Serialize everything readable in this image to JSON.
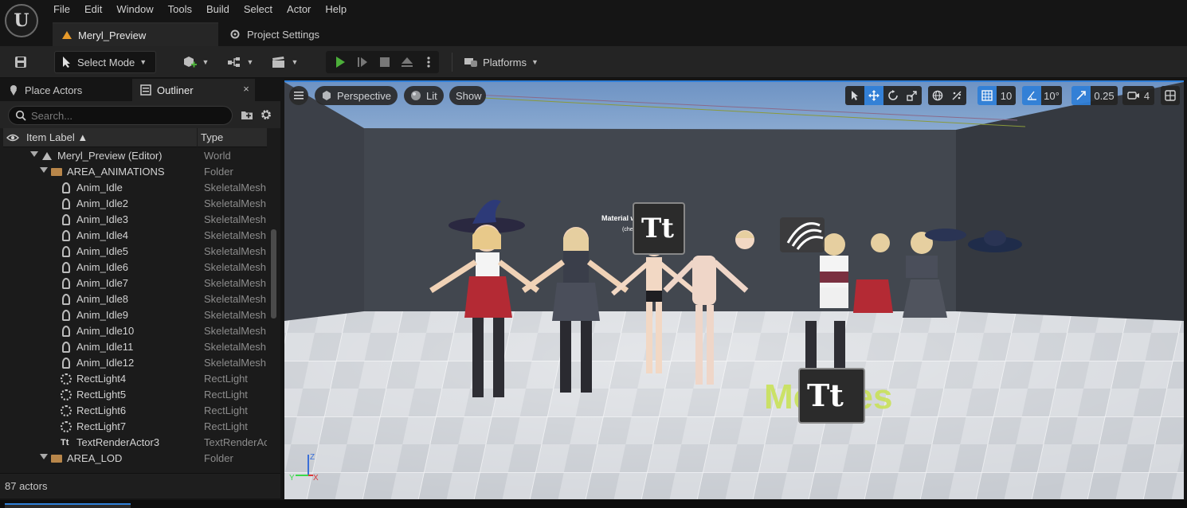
{
  "menu": [
    "File",
    "Edit",
    "Window",
    "Tools",
    "Build",
    "Select",
    "Actor",
    "Help"
  ],
  "tabs": {
    "level": "Meryl_Preview",
    "project": "Project Settings"
  },
  "toolbar": {
    "select_mode": "Select Mode",
    "platforms": "Platforms"
  },
  "panel": {
    "place_actors": "Place Actors",
    "outliner": "Outliner",
    "close": "×"
  },
  "search": {
    "placeholder": "Search..."
  },
  "columns": {
    "label": "Item Label ▲",
    "type": "Type"
  },
  "outliner_rows": [
    {
      "label": "Meryl_Preview (Editor)",
      "type": "World",
      "icon": "world-icon"
    },
    {
      "label": "AREA_ANIMATIONS",
      "type": "Folder",
      "icon": "folder-icon"
    },
    {
      "label": "Anim_Idle",
      "type": "SkeletalMesh",
      "icon": "skeletal-mesh-icon"
    },
    {
      "label": "Anim_Idle2",
      "type": "SkeletalMesh",
      "icon": "skeletal-mesh-icon"
    },
    {
      "label": "Anim_Idle3",
      "type": "SkeletalMesh",
      "icon": "skeletal-mesh-icon"
    },
    {
      "label": "Anim_Idle4",
      "type": "SkeletalMesh",
      "icon": "skeletal-mesh-icon"
    },
    {
      "label": "Anim_Idle5",
      "type": "SkeletalMesh",
      "icon": "skeletal-mesh-icon"
    },
    {
      "label": "Anim_Idle6",
      "type": "SkeletalMesh",
      "icon": "skeletal-mesh-icon"
    },
    {
      "label": "Anim_Idle7",
      "type": "SkeletalMesh",
      "icon": "skeletal-mesh-icon"
    },
    {
      "label": "Anim_Idle8",
      "type": "SkeletalMesh",
      "icon": "skeletal-mesh-icon"
    },
    {
      "label": "Anim_Idle9",
      "type": "SkeletalMesh",
      "icon": "skeletal-mesh-icon"
    },
    {
      "label": "Anim_Idle10",
      "type": "SkeletalMesh",
      "icon": "skeletal-mesh-icon"
    },
    {
      "label": "Anim_Idle11",
      "type": "SkeletalMesh",
      "icon": "skeletal-mesh-icon"
    },
    {
      "label": "Anim_Idle12",
      "type": "SkeletalMesh",
      "icon": "skeletal-mesh-icon"
    },
    {
      "label": "RectLight4",
      "type": "RectLight",
      "icon": "rect-light-icon"
    },
    {
      "label": "RectLight5",
      "type": "RectLight",
      "icon": "rect-light-icon"
    },
    {
      "label": "RectLight6",
      "type": "RectLight",
      "icon": "rect-light-icon"
    },
    {
      "label": "RectLight7",
      "type": "RectLight",
      "icon": "rect-light-icon"
    },
    {
      "label": "TextRenderActor3",
      "type": "TextRenderActor",
      "icon": "text-render-icon"
    },
    {
      "label": "AREA_LOD",
      "type": "Folder",
      "icon": "folder-icon"
    }
  ],
  "status": {
    "actor_count": "87 actors"
  },
  "viewport": {
    "perspective": "Perspective",
    "lit": "Lit",
    "show": "Show",
    "grid_snap": "10",
    "rotation_snap": "10°",
    "scale_snap": "0.25",
    "camera_speed": "4",
    "scene_text_sections": "Material with 5 Sections",
    "scene_text_sub": "(check MI Body)",
    "scene_text_meshes": "Meshes"
  },
  "colors": {
    "accent": "#2f7fd8",
    "play_green": "#4caf3a",
    "folder": "#b8864a",
    "level_icon": "#e79a2a",
    "meshes_text": "#c9e25a"
  }
}
